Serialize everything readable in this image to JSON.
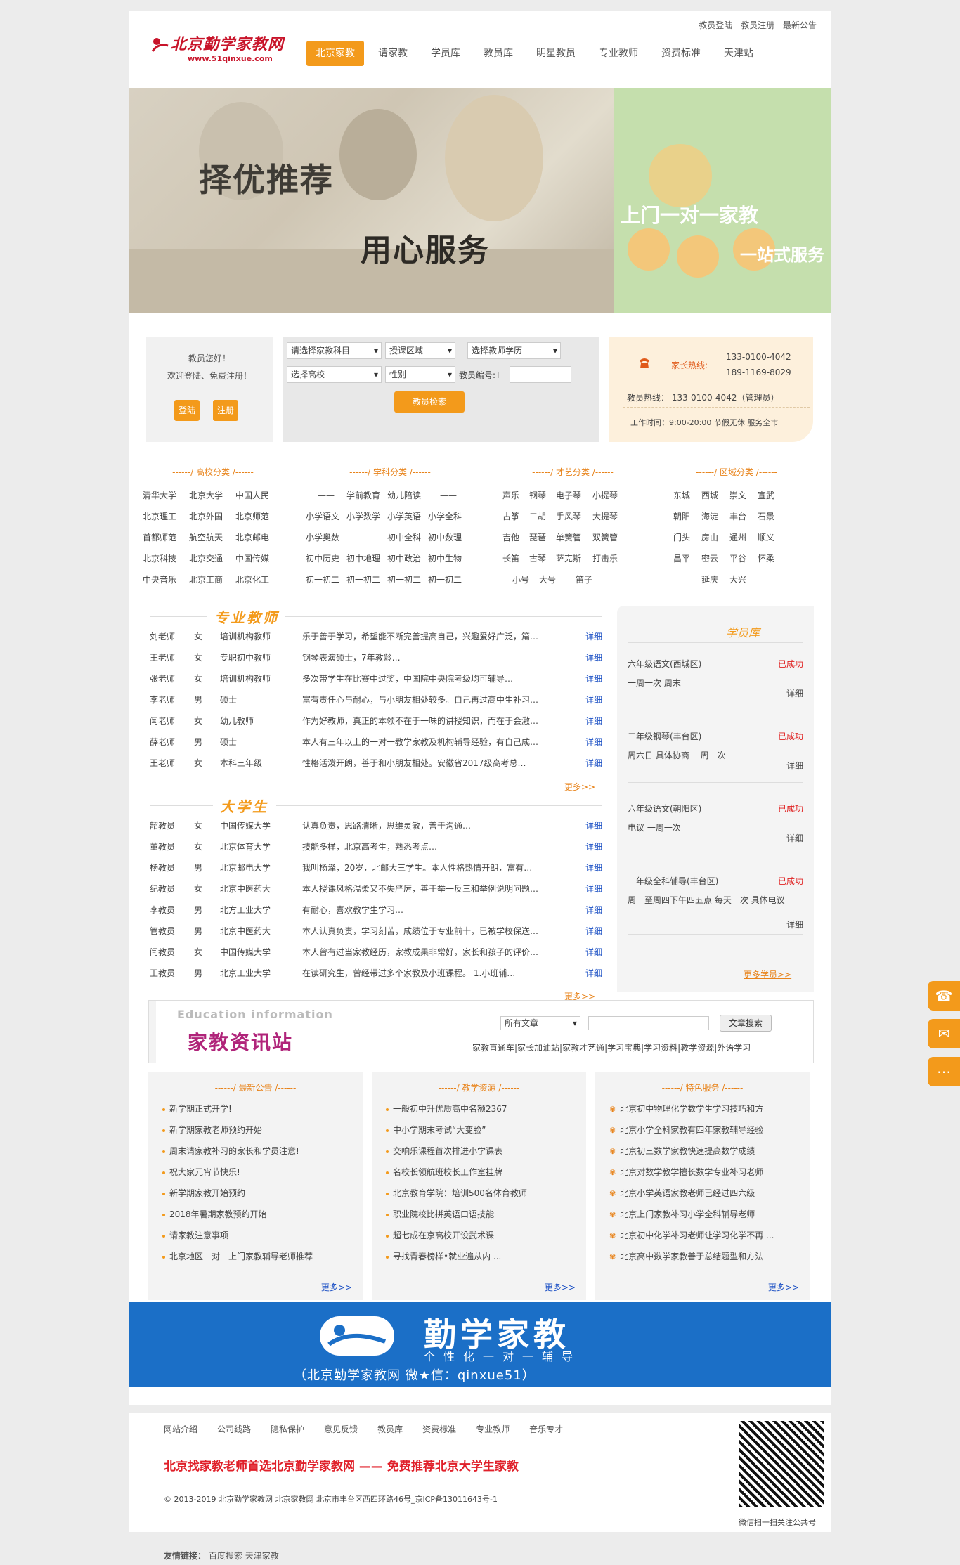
{
  "header": {
    "logo_text": "北京勤学家教网",
    "logo_url": "www.51qinxue.com",
    "top_links": [
      "教员登陆",
      "教员注册",
      "最新公告"
    ],
    "nav": [
      "北京家教",
      "请家教",
      "学员库",
      "教员库",
      "明星教员",
      "专业教师",
      "资费标准",
      "天津站"
    ]
  },
  "banner": {
    "slogan1": "择优推荐",
    "slogan2": "用心服务",
    "slogan3": "上门一对一家教",
    "slogan4": "一站式服务"
  },
  "login": {
    "greeting": "教员您好！",
    "welcome": "欢迎登陆、免费注册！",
    "login_btn": "登陆",
    "register_btn": "注册"
  },
  "search": {
    "subject": "请选择家教科目",
    "area": "授课区域",
    "education": "选择教师学历",
    "school": "选择高校",
    "gender": "性别",
    "teacher_no_label": "教员编号:T",
    "search_btn": "教员检索"
  },
  "hotline": {
    "parent_label": "家长热线:",
    "parent_phone1": "133-0100-4042",
    "parent_phone2": "189-1169-8029",
    "teacher_line": "教员热线：   133-0100-4042（管理员）",
    "hours": "工作时间：9:00-20:00 节假无休 服务全市"
  },
  "categories": [
    {
      "title": "------/ 高校分类 /------",
      "rows": [
        [
          "清华大学",
          "北京大学",
          "中国人民"
        ],
        [
          "北京理工",
          "北京外国",
          "北京师范"
        ],
        [
          "首都师范",
          "航空航天",
          "北京邮电"
        ],
        [
          "北京科技",
          "北京交通",
          "中国传媒"
        ],
        [
          "中央音乐",
          "北京工商",
          "北京化工"
        ]
      ]
    },
    {
      "title": "------/ 学科分类 /------",
      "rows": [
        [
          "——",
          "学前教育",
          "幼儿陪读",
          "——"
        ],
        [
          "小学语文",
          "小学数学",
          "小学英语",
          "小学全科"
        ],
        [
          "小学奥数",
          "——",
          "初中全科",
          "初中数理"
        ],
        [
          "初中历史",
          "初中地理",
          "初中政治",
          "初中生物"
        ],
        [
          "初一初二",
          "初一初二",
          "初一初二",
          "初一初二"
        ]
      ]
    },
    {
      "title": "------/ 才艺分类 /------",
      "rows": [
        [
          "声乐",
          "钢琴",
          "电子琴",
          "小提琴"
        ],
        [
          "古筝",
          "二胡",
          "手风琴",
          "大提琴"
        ],
        [
          "吉他",
          "琵琶",
          "单簧管",
          "双簧管"
        ],
        [
          "长笛",
          "古琴",
          "萨克斯",
          "打击乐"
        ],
        [
          "小号",
          "大号",
          "笛子"
        ]
      ]
    },
    {
      "title": "------/ 区域分类 /------",
      "rows": [
        [
          "东城",
          "西城",
          "崇文",
          "宣武"
        ],
        [
          "朝阳",
          "海淀",
          "丰台",
          "石景"
        ],
        [
          "门头",
          "房山",
          "通州",
          "顺义"
        ],
        [
          "昌平",
          "密云",
          "平谷",
          "怀柔"
        ],
        [
          "延庆",
          "大兴"
        ]
      ]
    }
  ],
  "pro_teachers": {
    "title": "专业教师",
    "more": "更多>>",
    "rows": [
      [
        "刘老师",
        "女",
        "培训机构教师",
        "乐于善于学习，希望能不断完善提高自己，兴趣爱好广泛，篇…",
        "详细"
      ],
      [
        "王老师",
        "女",
        "专职初中教师",
        "钢琴表演硕士，7年教龄…",
        "详细"
      ],
      [
        "张老师",
        "女",
        "培训机构教师",
        "多次带学生在比赛中过奖，中国院中央院考级均可辅导…",
        "详细"
      ],
      [
        "李老师",
        "男",
        "硕士",
        "富有责任心与耐心，与小朋友相处较多。自己再过高中生补习…",
        "详细"
      ],
      [
        "闫老师",
        "女",
        "幼儿教师",
        "作为好教师，真正的本领不在于一味的讲授知识，而在于会激…",
        "详细"
      ],
      [
        "薛老师",
        "男",
        "硕士",
        "本人有三年以上的一对一教学家教及机构辅导经验，有自己成…",
        "详细"
      ],
      [
        "王老师",
        "女",
        "本科三年级",
        "性格活泼开朗，善于和小朋友相处。安徽省2017级高考总…",
        "详细"
      ]
    ]
  },
  "students_teachers": {
    "title": "大学生",
    "more": "更多>>",
    "rows": [
      [
        "韶教员",
        "女",
        "中国传媒大学",
        "认真负责，思路清晰，思维灵敏，善于沟通…",
        "详细"
      ],
      [
        "董教员",
        "女",
        "北京体育大学",
        "技能多样，北京高考生，熟悉考点…",
        "详细"
      ],
      [
        "杨教员",
        "男",
        "北京邮电大学",
        "我叫杨泽，20岁，北邮大三学生。本人性格热情开朗，富有…",
        "详细"
      ],
      [
        "纪教员",
        "女",
        "北京中医药大",
        "本人授课风格温柔又不失严厉，善于举一反三和举例说明问题…",
        "详细"
      ],
      [
        "李教员",
        "男",
        "北方工业大学",
        "有耐心，喜欢教学生学习…",
        "详细"
      ],
      [
        "管教员",
        "男",
        "北京中医药大",
        "本人认真负责，学习刻苦，成绩位于专业前十，已被学校保送…",
        "详细"
      ],
      [
        "闫教员",
        "女",
        "中国传媒大学",
        "本人曾有过当家教经历，家教成果非常好，家长和孩子的评价…",
        "详细"
      ],
      [
        "王教员",
        "男",
        "北京工业大学",
        "在读研究生，曾经带过多个家教及小班课程。 1.小班辅…",
        "详细"
      ]
    ]
  },
  "student_lib": {
    "title": "学员库",
    "more": "更多学员>>",
    "cards": [
      {
        "title": "六年级语文(西城区)",
        "status": "已成功",
        "desc": "一周一次  周末",
        "detail": "详细"
      },
      {
        "title": "二年级钢琴(丰台区)",
        "status": "已成功",
        "desc": "周六日  具体协商  一周一次",
        "detail": "详细"
      },
      {
        "title": "六年级语文(朝阳区)",
        "status": "已成功",
        "desc": "电议  一周一次",
        "detail": "详细"
      },
      {
        "title": "一年级全科辅导(丰台区)",
        "status": "已成功",
        "desc": "周一至周四下午四五点  每天一次  具体电议",
        "detail": "详细"
      }
    ]
  },
  "news": {
    "en_title": "Education information",
    "cn_title": "家教资讯站",
    "select": "所有文章",
    "search_btn": "文章搜索",
    "links": "家教直通车|家长加油站|家教才艺通|学习宝典|学习资料|教学资源|外语学习"
  },
  "notices": [
    {
      "title": "------/ 最新公告 /------",
      "items": [
        "新学期正式开学!",
        "新学期家教老师预约开始",
        "周末请家教补习的家长和学员注意!",
        "祝大家元宵节快乐!",
        "新学期家教开始预约",
        "2018年暑期家教预约开始",
        "请家教注意事项",
        "北京地区一对一上门家教辅导老师推荐"
      ],
      "more": "更多>>"
    },
    {
      "title": "------/ 教学资源 /------",
      "items": [
        "一般初中升优质高中名额2367",
        "中小学期末考试“大变脸”",
        "交响乐课程首次排进小学课表",
        "名校长领航班校长工作室挂牌",
        "北京教育学院：培训500名体育教师",
        "职业院校比拼英语口语技能",
        "超七成在京高校开设武术课",
        "寻找青春榜样•就业遍从内 ..."
      ],
      "more": "更多>>"
    },
    {
      "title": "------/ 特色服务 /------",
      "items": [
        "北京初中物理化学数学生学习技巧和方",
        "北京小学全科家教有四年家教辅导经验",
        "北京初三数学家教快速提高数学成绩",
        "北京对数学教学擅长数学专业补习老师",
        "北京小学英语家教老师已经过四六级",
        "北京上门家教补习小学全科辅导老师",
        "北京初中化学补习老师让学习化学不再 ...",
        "北京高中数学家教善于总结题型和方法"
      ],
      "more": "更多>>"
    }
  ],
  "adbanner": {
    "title": "勤学家教",
    "subtitle": "个性化一对一辅导",
    "footer": "（北京勤学家教网  微★信：qinxue51）"
  },
  "footer": {
    "links": [
      "网站介绍",
      "公司线路",
      "隐私保护",
      "意见反馈",
      "教员库",
      "资费标准",
      "专业教师",
      "音乐专才"
    ],
    "headline": "北京找家教老师首选北京勤学家教网 —— 免费推荐北京大学生家教",
    "copyright": "© 2013-2019 北京勤学家教网 北京家教网 北京市丰台区西四环路46号_京ICP备13011643号-1",
    "qr_caption": "微信扫一扫关注公共号",
    "friend_label": "友情链接：",
    "friend_links": [
      "百度搜索",
      "天津家教"
    ]
  },
  "colors": {
    "accent": "#f39a1b",
    "link_blue": "#1a4fc4",
    "red": "#c8142a"
  }
}
